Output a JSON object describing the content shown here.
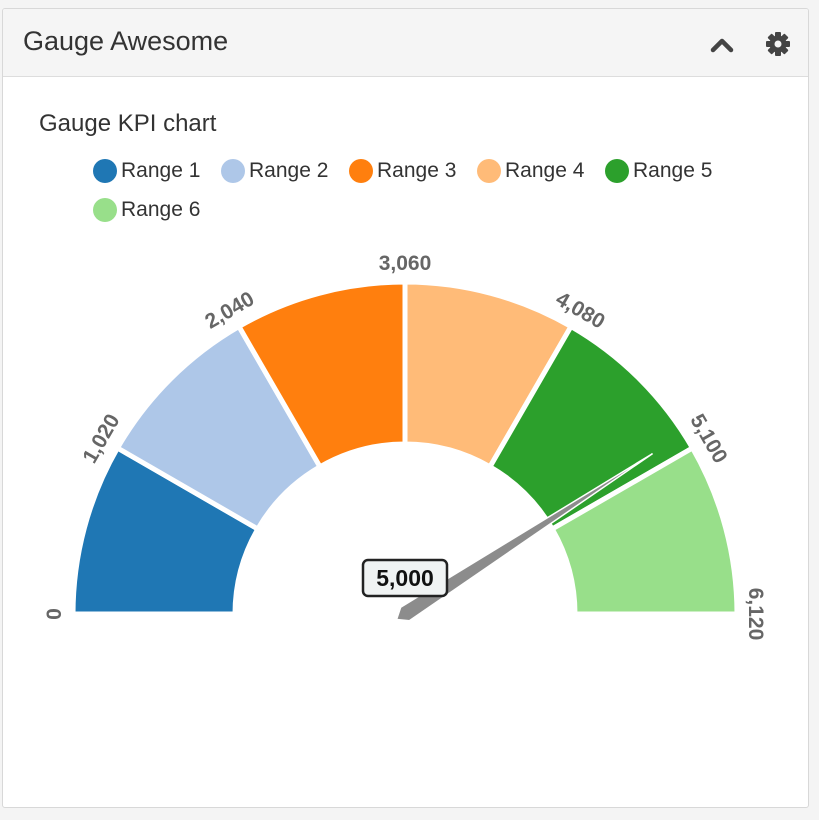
{
  "panel": {
    "title": "Gauge Awesome",
    "icons": [
      "chevron-up-icon",
      "gear-icon"
    ]
  },
  "chart_data": {
    "type": "gauge",
    "title": "Gauge KPI chart",
    "min": 0,
    "max": 6120,
    "value": 5000,
    "value_label": "5,000",
    "ranges": [
      {
        "name": "Range 1",
        "from": 0,
        "to": 1020,
        "color": "#1f77b4"
      },
      {
        "name": "Range 2",
        "from": 1020,
        "to": 2040,
        "color": "#aec7e8"
      },
      {
        "name": "Range 3",
        "from": 2040,
        "to": 3060,
        "color": "#ff7f0e"
      },
      {
        "name": "Range 4",
        "from": 3060,
        "to": 4080,
        "color": "#ffbb78"
      },
      {
        "name": "Range 5",
        "from": 4080,
        "to": 5100,
        "color": "#2ca02c"
      },
      {
        "name": "Range 6",
        "from": 5100,
        "to": 6120,
        "color": "#98df8a"
      }
    ],
    "tick_labels": [
      "0",
      "1,020",
      "2,040",
      "3,060",
      "4,080",
      "5,100",
      "6,120"
    ],
    "legend_position": "top"
  }
}
